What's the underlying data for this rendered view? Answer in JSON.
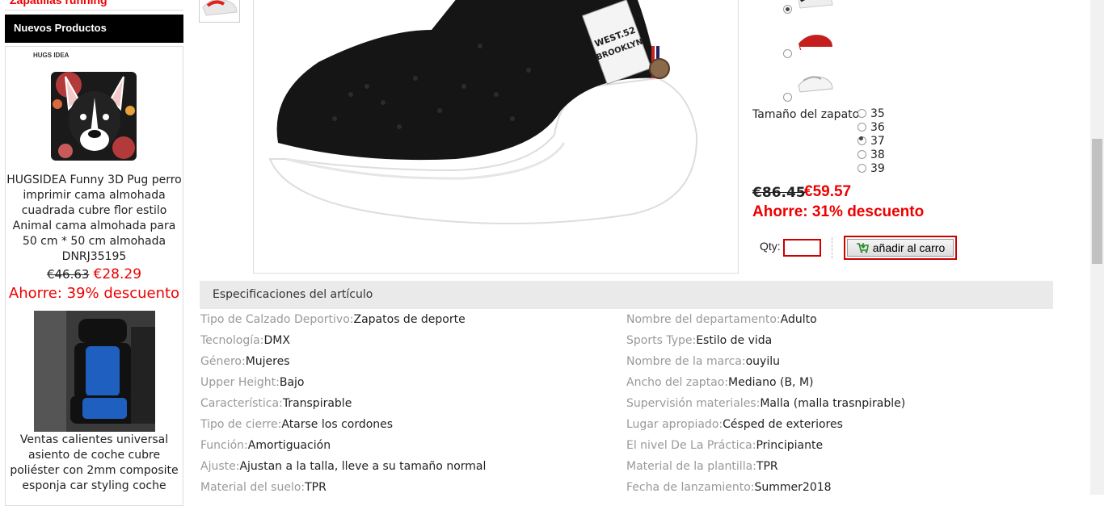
{
  "sidebar": {
    "top_link": "Zapatillas running",
    "section_title": "Nuevos Productos",
    "products": [
      {
        "title": "HUGSIDEA Funny 3D Pug perro imprimir cama almohada cuadrada cubre flor estilo Animal cama almohada para 50 cm * 50 cm almohada DNRJ35195",
        "old_price": "€46.63",
        "new_price": "€28.29",
        "save": "Ahorre: 39% descuento",
        "brand_logo": "HUGS IDEA"
      },
      {
        "title": "Ventas calientes universal asiento de coche cubre poliéster con 2mm composite esponja car styling coche"
      }
    ]
  },
  "product": {
    "image_labels": [
      "WEST.52",
      "BROOKLYN"
    ],
    "size_label": "Tamaño del zapato",
    "sizes": [
      "35",
      "36",
      "37",
      "38",
      "39"
    ],
    "selected_size": "37",
    "old_price": "€86.45",
    "new_price": "€59.57",
    "save": "Ahorre: 31% descuento",
    "qty_label": "Qty:",
    "qty_value": "",
    "cart_button": "añadir al carro"
  },
  "specs": {
    "title": "Especificaciones del artículo",
    "left": [
      {
        "key": "Tipo de Calzado Deportivo:",
        "value": "Zapatos de deporte"
      },
      {
        "key": "Tecnología:",
        "value": "DMX"
      },
      {
        "key": "Género:",
        "value": "Mujeres"
      },
      {
        "key": "Upper Height:",
        "value": "Bajo"
      },
      {
        "key": "Característica:",
        "value": "Transpirable"
      },
      {
        "key": "Tipo de cierre:",
        "value": "Atarse los cordones"
      },
      {
        "key": "Función:",
        "value": "Amortiguación"
      },
      {
        "key": "Ajuste:",
        "value": "Ajustan a la talla, lleve a su tamaño normal"
      },
      {
        "key": "Material del suelo:",
        "value": "TPR"
      }
    ],
    "right": [
      {
        "key": "Nombre del departamento:",
        "value": "Adulto"
      },
      {
        "key": "Sports Type:",
        "value": "Estilo de vida"
      },
      {
        "key": "Nombre de la marca:",
        "value": "ouyilu"
      },
      {
        "key": "Ancho del zaptao:",
        "value": "Mediano (B, M)"
      },
      {
        "key": "Supervisión materiales:",
        "value": "Malla (malla trasnpirable)"
      },
      {
        "key": "Lugar apropiado:",
        "value": "Césped de exteriores"
      },
      {
        "key": "El nivel De La Práctica:",
        "value": "Principiante"
      },
      {
        "key": "Material de la plantilla:",
        "value": "TPR"
      },
      {
        "key": "Fecha de lanzamiento:",
        "value": "Summer2018"
      }
    ]
  },
  "colors": {
    "accent_red": "#e00000",
    "header_black": "#000000",
    "spec_header_bg": "#eaeaea"
  }
}
